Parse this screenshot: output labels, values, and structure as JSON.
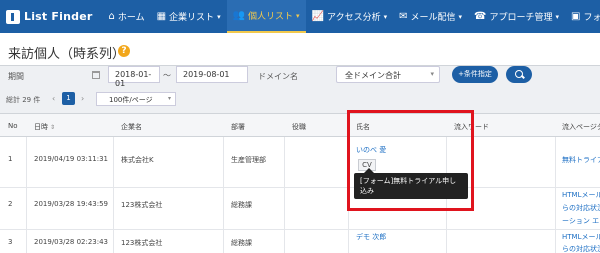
{
  "navbar": {
    "logo": "List Finder",
    "items": [
      {
        "label": "ホーム",
        "icon": "home-icon",
        "glyph": "⌂",
        "active": false,
        "caret": false
      },
      {
        "label": "企業リスト",
        "icon": "building-icon",
        "glyph": "▦",
        "active": false,
        "caret": true
      },
      {
        "label": "個人リスト",
        "icon": "users-icon",
        "glyph": "👥",
        "active": true,
        "caret": true
      },
      {
        "label": "アクセス分析",
        "icon": "chart-icon",
        "glyph": "📈",
        "active": false,
        "caret": true
      },
      {
        "label": "メール配信",
        "icon": "mail-icon",
        "glyph": "✉",
        "active": false,
        "caret": true
      },
      {
        "label": "アプローチ管理",
        "icon": "phone-icon",
        "glyph": "☎",
        "active": false,
        "caret": true
      },
      {
        "label": "フォーム管理",
        "icon": "form-icon",
        "glyph": "▣",
        "active": false,
        "caret": true
      },
      {
        "label": "",
        "icon": "gear-icon",
        "glyph": "⚙",
        "active": false,
        "caret": false
      }
    ]
  },
  "page": {
    "title": "来訪個人（時系列）",
    "help": "?"
  },
  "filter": {
    "period_label": "期間",
    "date_from": "2018-01-01",
    "date_sep": "〜",
    "date_to": "2019-08-01",
    "domain_label": "ドメイン名",
    "domain_value": "全ドメイン合計",
    "condition_button": "+条件指定"
  },
  "pager": {
    "total": "総計 29 件",
    "prev": "‹",
    "page": "1",
    "next": "›",
    "per_page": "100件/ページ"
  },
  "table": {
    "headers": {
      "no": "No",
      "datetime": "日時",
      "company": "企業名",
      "dept": "部署",
      "title": "役職",
      "name": "氏名",
      "keyword": "流入ワード",
      "page": "流入ページタ"
    },
    "sort_mark": "⇕",
    "rows": [
      {
        "no": "1",
        "datetime": "2019/04/19 03:11:31",
        "company": "株式会社K",
        "dept": "生産管理部",
        "title": "",
        "name": "いのべ 愛",
        "badge": "CV",
        "keyword": "",
        "page_lines": [
          "無料トライア"
        ]
      },
      {
        "no": "2",
        "datetime": "2019/03/28 19:43:59",
        "company": "123株式会社",
        "dept": "総務課",
        "title": "",
        "name": "",
        "badge": "",
        "keyword": "",
        "page_lines": [
          "HTMLメール",
          "らの対応状況",
          "ーション エ"
        ]
      },
      {
        "no": "3",
        "datetime": "2019/03/28 02:23:43",
        "company": "123株式会社",
        "dept": "総務課",
        "title": "",
        "name": "デモ 次郎",
        "badge": "",
        "keyword": "",
        "page_lines": [
          "HTMLメール",
          "らの対応状況"
        ]
      }
    ]
  },
  "tooltip": {
    "text": "[フォーム]無料トライアル申し込み"
  },
  "colors": {
    "nav": "#1d5fa5",
    "active": "#f2c94c",
    "highlight": "#e0141e",
    "link": "#1d6fc4"
  }
}
